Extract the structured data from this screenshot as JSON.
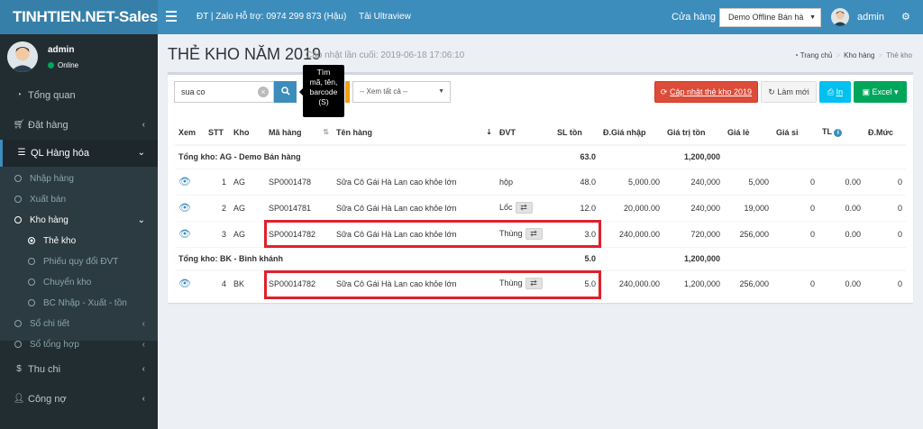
{
  "app": {
    "brand": "TINHTIEN.NET-Sales"
  },
  "header": {
    "support": "ĐT | Zalo Hỗ trợ: 0974 299 873 (Hậu)",
    "ultraview": "Tải Ultraview",
    "store_label": "Cửa hàng",
    "store_value": "Demo Offline Bán hà",
    "user": "admin"
  },
  "sidebar": {
    "user": "admin",
    "status": "Online",
    "items": [
      {
        "label": "Tổng quan",
        "icon": "dashboard-icon"
      },
      {
        "label": "Đặt hàng",
        "icon": "cart-icon"
      },
      {
        "label": "QL Hàng hóa",
        "icon": "list-icon"
      },
      {
        "label": "Thu chi",
        "icon": "dollar-icon"
      },
      {
        "label": "Công nợ",
        "icon": "user-icon"
      }
    ],
    "sub": {
      "nhap_hang": "Nhập hàng",
      "xuat_ban": "Xuất bán",
      "kho_hang": "Kho hàng",
      "the_kho": "Thẻ kho",
      "phieu_quy_doi": "Phiếu quy đổi ĐVT",
      "chuyen_kho": "Chuyển kho",
      "bc_nxt": "BC Nhập - Xuất - tồn",
      "so_chi_tiet": "Sổ chi tiết",
      "so_tong_hop": "Sổ tổng hợp"
    }
  },
  "page": {
    "title": "THẺ KHO NĂM 2019",
    "updated": "Cập nhật lần cuối: 2019-06-18 17:06:10",
    "breadcrumb": {
      "home": "Trang chủ",
      "mid": "Kho hàng",
      "current": "Thẻ kho"
    }
  },
  "toolbar": {
    "search_value": "sua co",
    "tooltip": [
      "Tìm",
      "mã, tên,",
      "barcode",
      "(S)"
    ],
    "filter": "-- Xem tất cả --",
    "update_btn": "Cập nhật thẻ kho 2019",
    "refresh_btn": "Làm mới",
    "print_btn": "In",
    "excel_btn": "Excel"
  },
  "table": {
    "headers": {
      "xem": "Xem",
      "stt": "STT",
      "kho": "Kho",
      "ma": "Mã hàng",
      "ten": "Tên hàng",
      "dvt": "ĐVT",
      "slton": "SL tồn",
      "gianhap": "Đ.Giá nhập",
      "giatri": "Giá trị tồn",
      "giale": "Giá lẻ",
      "giasi": "Giá sỉ",
      "tl": "TL",
      "dmuc": "Đ.Mức"
    },
    "groups": [
      {
        "title": "Tổng kho: AG - Demo Bán hàng",
        "slton": "63.0",
        "giatri": "1,200,000",
        "rows": [
          {
            "stt": "1",
            "kho": "AG",
            "ma": "SP0001478",
            "ten": "Sữa Cô Gái Hà Lan cao khỏe lớn",
            "dvt": "hộp",
            "swap": false,
            "slton": "48.0",
            "gianhap": "5,000.00",
            "giatri": "240,000",
            "giale": "5,000",
            "giasi": "0",
            "tl": "0.00",
            "dmuc": "0"
          },
          {
            "stt": "2",
            "kho": "AG",
            "ma": "SP0014781",
            "ten": "Sữa Cô Gái Hà Lan cao khỏe lớn",
            "dvt": "Lốc",
            "swap": true,
            "slton": "12.0",
            "gianhap": "20,000.00",
            "giatri": "240,000",
            "giale": "19,000",
            "giasi": "0",
            "tl": "0.00",
            "dmuc": "0"
          },
          {
            "stt": "3",
            "kho": "AG",
            "ma": "SP00014782",
            "ten": "Sữa Cô Gái Hà Lan cao khỏe lớn",
            "dvt": "Thùng",
            "swap": true,
            "slton": "3.0",
            "gianhap": "240,000.00",
            "giatri": "720,000",
            "giale": "256,000",
            "giasi": "0",
            "tl": "0.00",
            "dmuc": "0"
          }
        ]
      },
      {
        "title": "Tổng kho: BK - Bình khánh",
        "slton": "5.0",
        "giatri": "1,200,000",
        "rows": [
          {
            "stt": "4",
            "kho": "BK",
            "ma": "SP00014782",
            "ten": "Sữa Cô Gái Hà Lan cao khỏe lớn",
            "dvt": "Thùng",
            "swap": true,
            "slton": "5.0",
            "gianhap": "240,000.00",
            "giatri": "1,200,000",
            "giale": "256,000",
            "giasi": "0",
            "tl": "0.00",
            "dmuc": "0"
          }
        ]
      }
    ]
  },
  "colors": {
    "topbar": "#3c8dbc",
    "logo": "#367fa9",
    "sidebar": "#222d32",
    "highlight": "#e0202a"
  }
}
